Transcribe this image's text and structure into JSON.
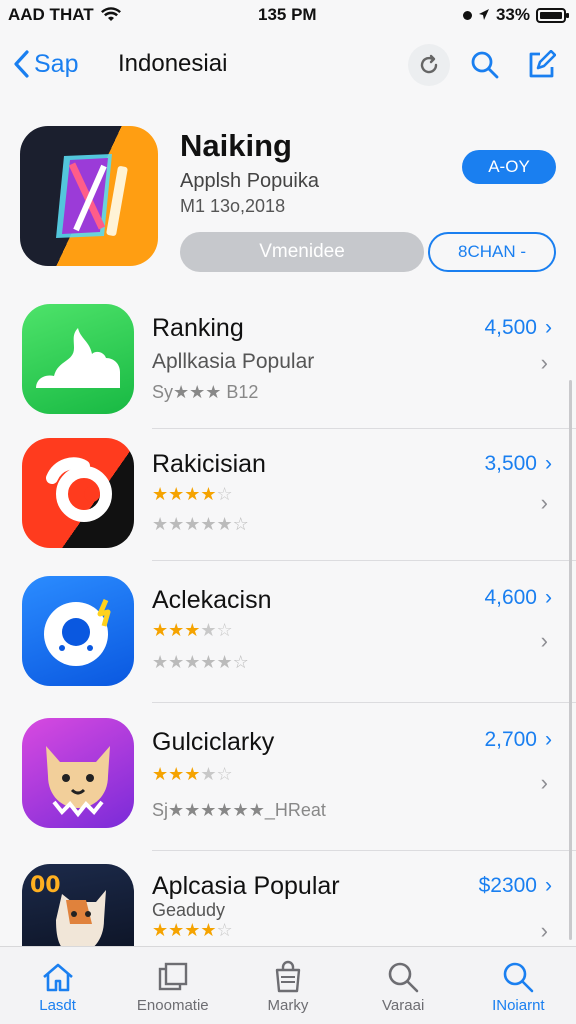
{
  "status": {
    "carrier": "AAD THAT",
    "time": "135 PM",
    "battery": "33%"
  },
  "nav": {
    "back_label": "Sap",
    "title": "Indonesiai"
  },
  "featured": {
    "name": "Naiking",
    "subtitle": "Applsh Popuika",
    "meta": "M1 13o,2018",
    "get_label": "A-OY",
    "gray_label": "Vmenidee",
    "outline_label": "8CHAN -"
  },
  "apps": [
    {
      "name": "Ranking",
      "subtitle": "Apllkasia Popular",
      "extra": "Sy★★★  B12",
      "price": "4,500"
    },
    {
      "name": "Rakicisian",
      "stars": "★★★★",
      "stars_off": "☆",
      "rating2": "★★★★★☆",
      "price": "3,500"
    },
    {
      "name": "Aclekacisn",
      "stars": "★★★",
      "stars_off": "★☆",
      "rating2": "★★★★★☆",
      "price": "4,600"
    },
    {
      "name": "Gulciclarky",
      "stars": "★★★",
      "stars_off": "★☆",
      "extra": "Sj★★★★★★_HReat",
      "price": "2,700"
    },
    {
      "name": "Aplcasia Popular",
      "subtitle": "Geadudy",
      "stars": "★★★★",
      "stars_off": "☆",
      "price": "$2300"
    }
  ],
  "tabs": [
    {
      "label": "Lasdt"
    },
    {
      "label": "Enoomatie"
    },
    {
      "label": "Marky"
    },
    {
      "label": "Varaai"
    },
    {
      "label": "INoiarnt"
    }
  ],
  "colors": {
    "accent": "#1a7ff0",
    "star": "#f5a300"
  }
}
